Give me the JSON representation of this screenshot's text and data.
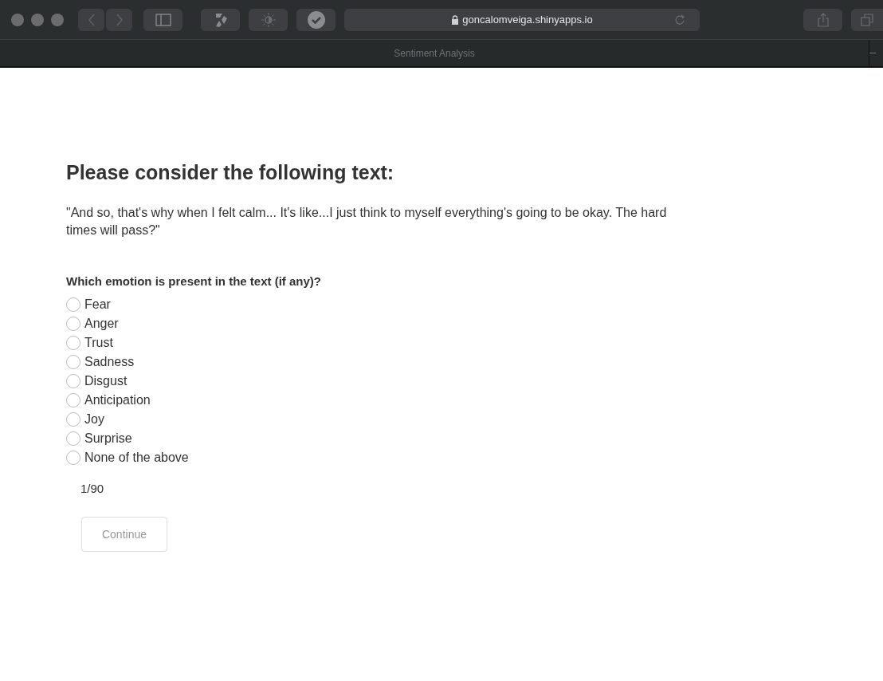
{
  "browser": {
    "address": "goncalomveiga.shinyapps.io",
    "tab_title": "Sentiment Analysis"
  },
  "heading": "Please consider the following text:",
  "quote": "\"And so, that's why when I felt calm... It's like...I just think to myself everything's going to be okay. The hard times will pass?\"",
  "question": {
    "label": "Which emotion is present in the text (if any)?",
    "options": [
      {
        "label": "Fear",
        "selected": false
      },
      {
        "label": "Anger",
        "selected": false
      },
      {
        "label": "Trust",
        "selected": false
      },
      {
        "label": "Sadness",
        "selected": false
      },
      {
        "label": "Disgust",
        "selected": false
      },
      {
        "label": "Anticipation",
        "selected": false
      },
      {
        "label": "Joy",
        "selected": false
      },
      {
        "label": "Surprise",
        "selected": false
      },
      {
        "label": "None of the above",
        "selected": false
      }
    ]
  },
  "progress": "1/90",
  "continue_button": {
    "label": "Continue",
    "disabled": true
  }
}
